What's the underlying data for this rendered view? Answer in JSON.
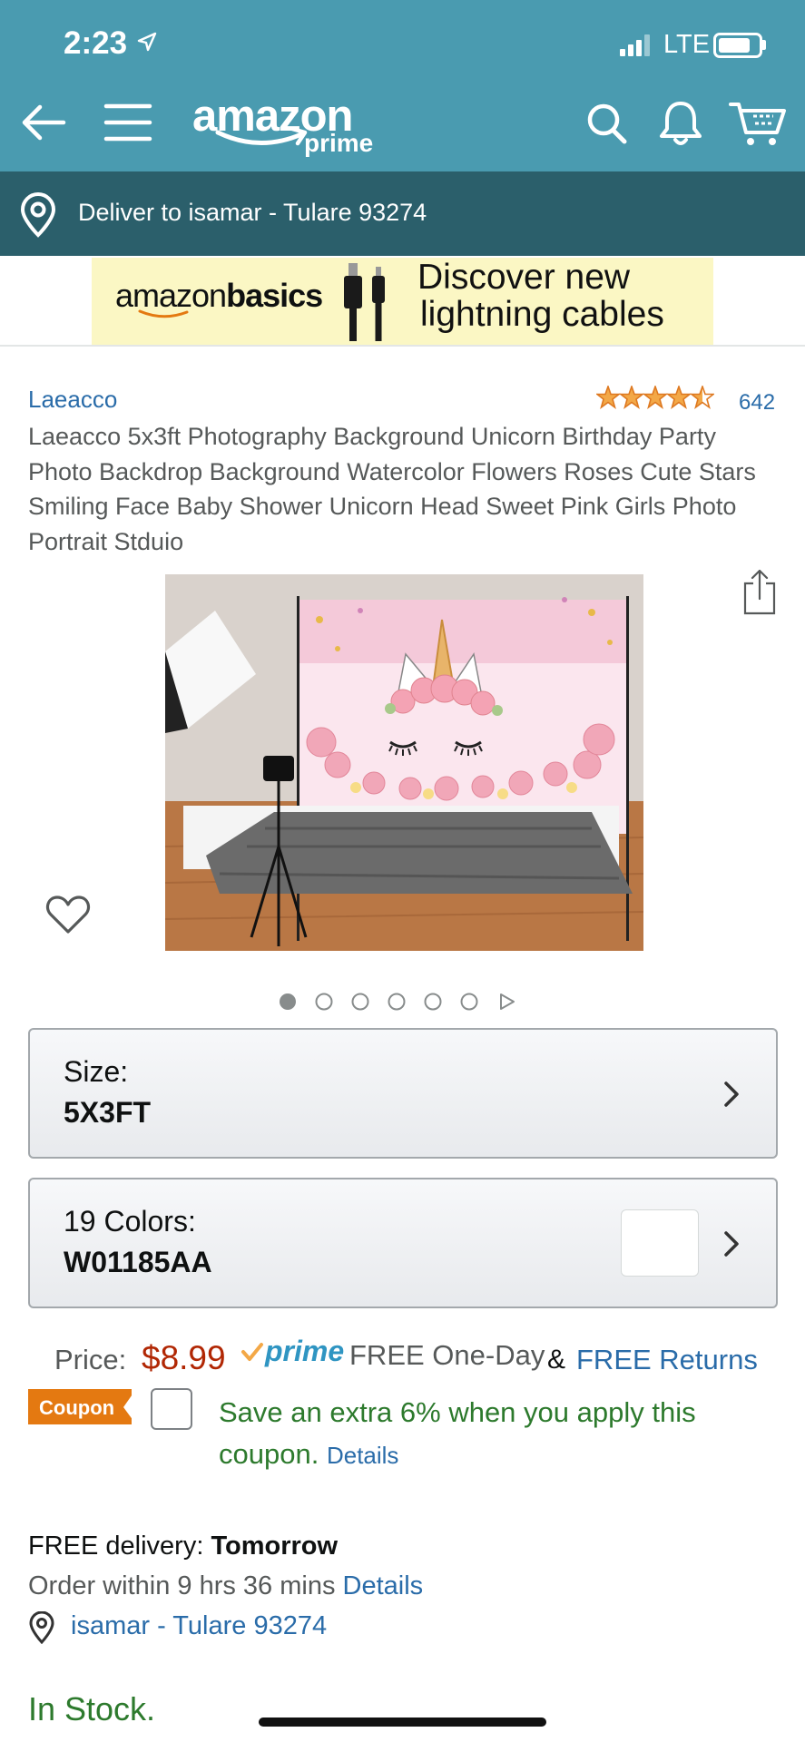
{
  "status_bar": {
    "time": "2:23",
    "network": "LTE"
  },
  "header": {
    "logo_text": "amazon",
    "logo_sub": "prime"
  },
  "deliver": {
    "text": "Deliver to isamar - Tulare 93274"
  },
  "banner": {
    "brand_prefix": "amazon",
    "brand_suffix": "basics",
    "line1": "Discover new",
    "line2": "lightning cables"
  },
  "product": {
    "brand": "Laeacco",
    "rating_stars": 4.5,
    "rating_count": "642",
    "title": "Laeacco 5x3ft Photography Background Unicorn Birthday Party Photo Backdrop Background Watercolor Flowers Roses Cute Stars Smiling Face Baby Shower Unicorn Head Sweet Pink Girls Photo Portrait Stduio",
    "image_count": 6,
    "active_image": 1
  },
  "size": {
    "label": "Size:",
    "value": "5X3FT"
  },
  "colors": {
    "label": "19 Colors:",
    "value": "W01185AA"
  },
  "price": {
    "label": "Price:",
    "amount": "$8.99",
    "prime": "prime",
    "one_day": "FREE One-Day",
    "amp": "&",
    "returns": "FREE Returns"
  },
  "coupon": {
    "badge": "Coupon",
    "text": "Save an extra 6% when you apply this coupon.",
    "details": "Details"
  },
  "delivery": {
    "prefix": "FREE delivery:",
    "day": "Tomorrow",
    "order_within": "Order within 9 hrs 36 mins",
    "details": "Details",
    "address": "isamar - Tulare 93274"
  },
  "stock": "In Stock.",
  "colors_theme": {
    "header": "#4a9bb0",
    "deliver_bar": "#2b5f6b",
    "price": "#b12704",
    "link": "#2a6ca9",
    "success": "#2d7a2d",
    "coupon": "#e47911"
  }
}
